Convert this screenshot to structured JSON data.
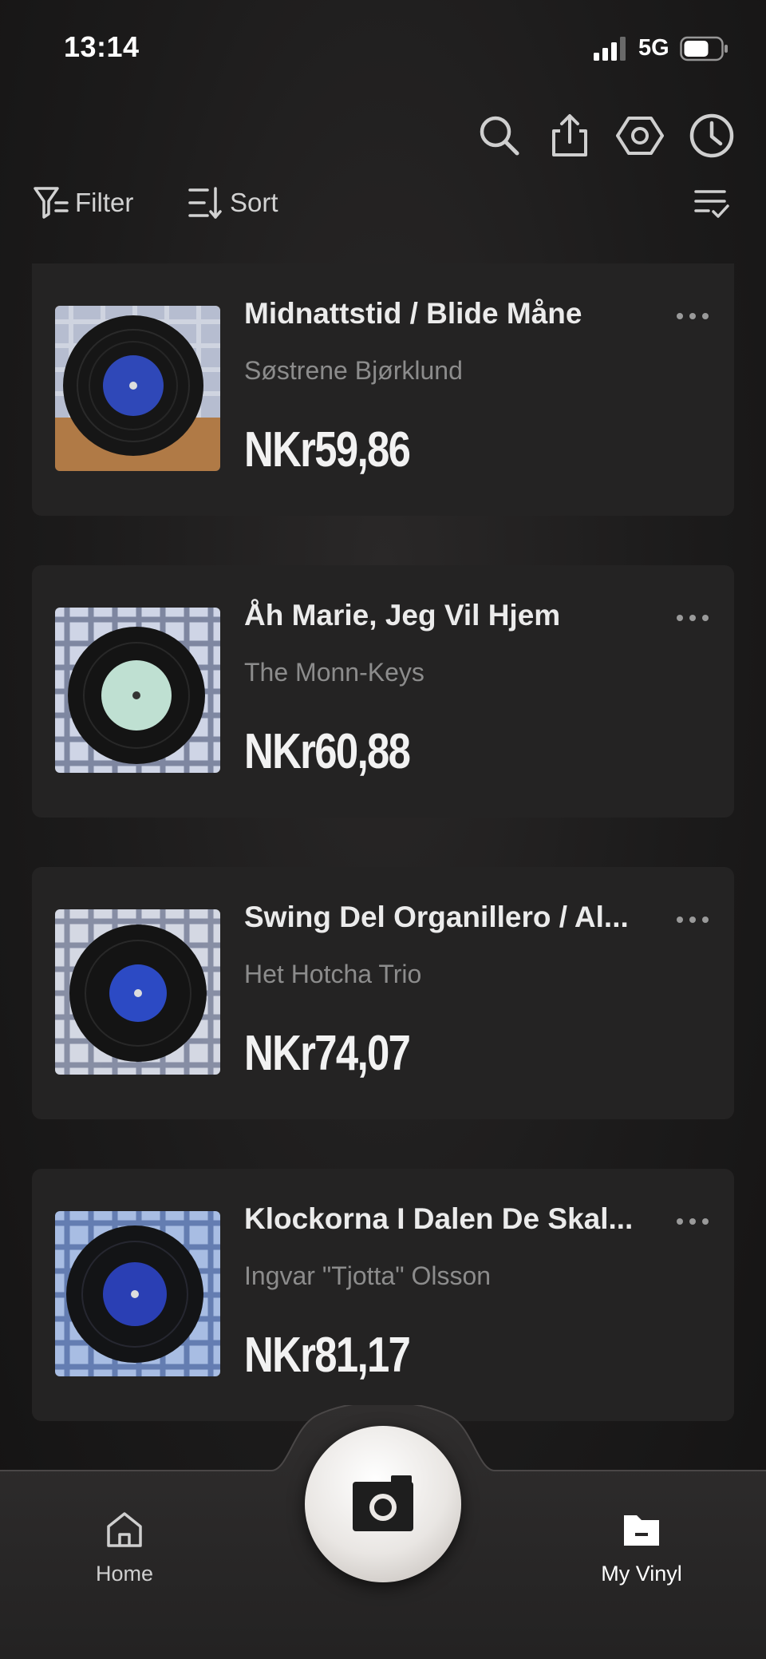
{
  "status_bar": {
    "time": "13:14",
    "network": "5G"
  },
  "header": {
    "icons": [
      "search-icon",
      "share-icon",
      "settings-icon",
      "history-icon"
    ],
    "filter_label": "Filter",
    "sort_label": "Sort"
  },
  "records": [
    {
      "title": "Midnattstid / Blide Måne",
      "artist": "Søstrene Bjørklund",
      "price": "NKr59,86",
      "label_color": "#2f48b8",
      "cloth_color": "#b6bdd0",
      "bg_color": "#b07a46"
    },
    {
      "title": "Åh Marie, Jeg Vil Hjem",
      "artist": "The Monn-Keys",
      "price": "NKr60,88",
      "label_color": "#bfe0d2",
      "cloth_color": "#c8cfe2",
      "bg_color": "#cfd5e6"
    },
    {
      "title": "Swing Del Organillero / Al...",
      "artist": "Het Hotcha Trio",
      "price": "NKr74,07",
      "label_color": "#2c4ac4",
      "cloth_color": "#c6cbd9",
      "bg_color": "#d4d8e3"
    },
    {
      "title": "Klockorna I Dalen De Skal...",
      "artist": "Ingvar \"Tjotta\" Olsson",
      "price": "NKr81,17",
      "label_color": "#2a3fb4",
      "cloth_color": "#7f9bd0",
      "bg_color": "#a8bde3"
    }
  ],
  "nav": {
    "home_label": "Home",
    "camera_icon": "camera-icon",
    "vinyl_label": "My Vinyl",
    "active_tab": "My Vinyl"
  },
  "colors": {
    "background": "#1b1a1a",
    "card": "#242323",
    "secondary_text": "#8c8c8c"
  }
}
